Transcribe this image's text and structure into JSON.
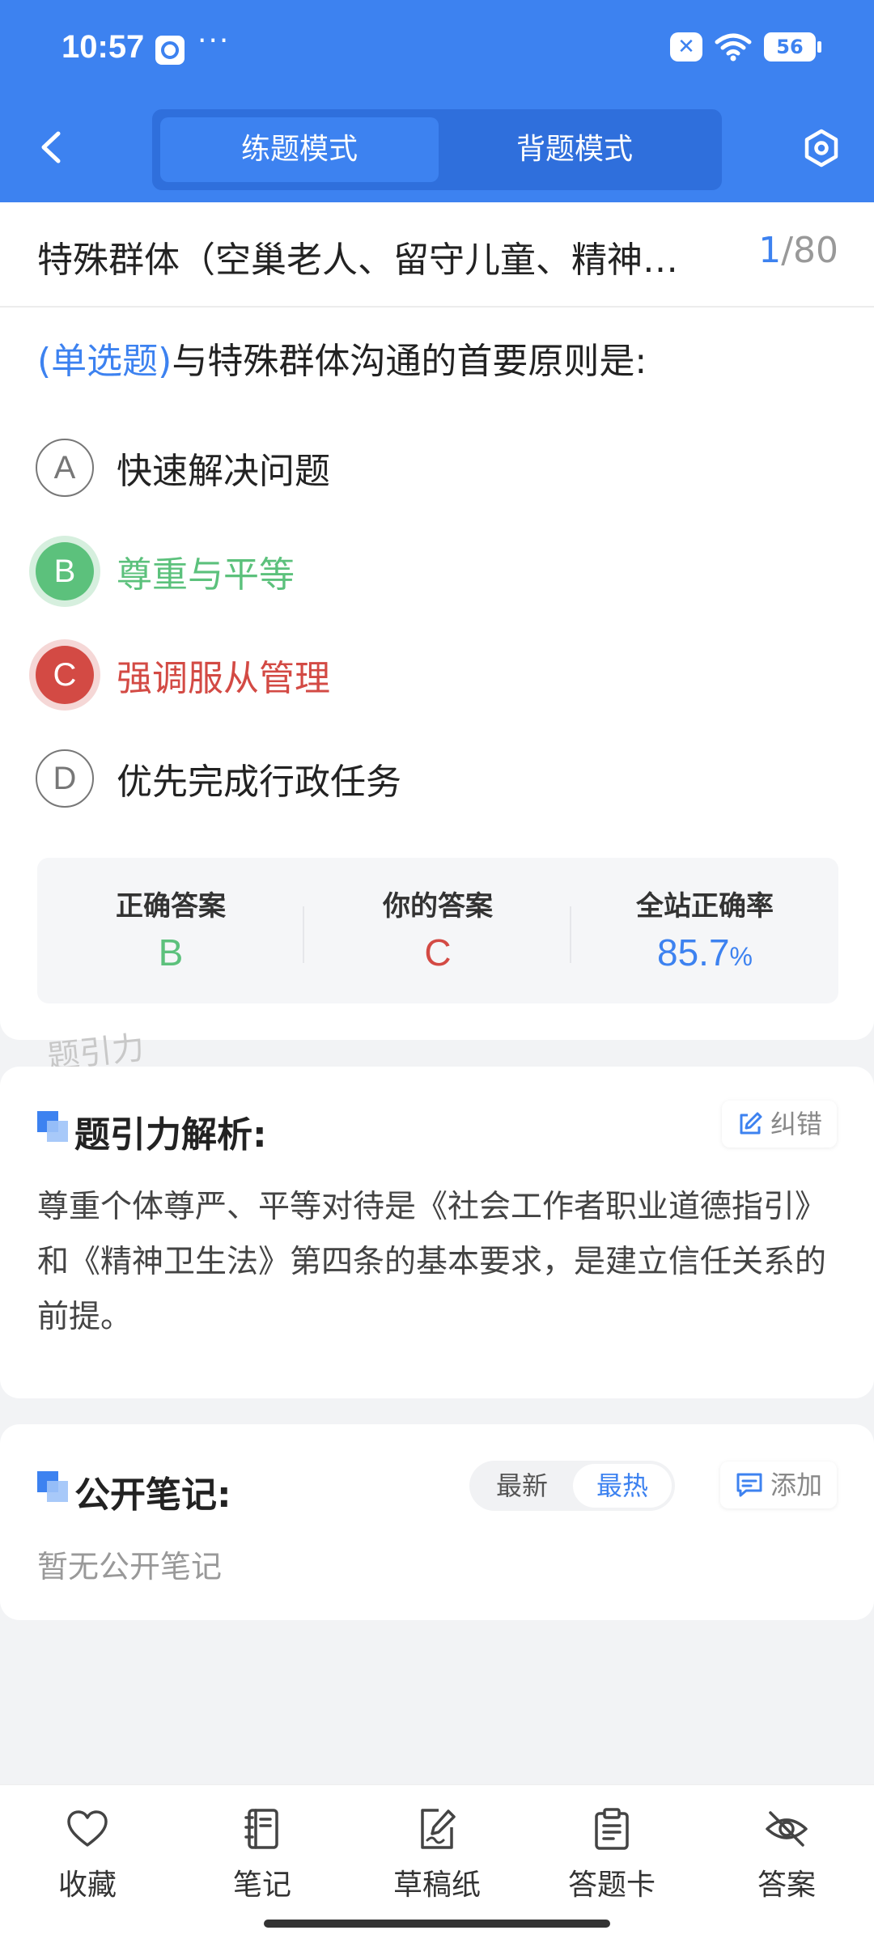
{
  "status_bar": {
    "time": "10:57",
    "dots": "···",
    "battery": "56"
  },
  "header": {
    "tabs": [
      {
        "label": "练题模式",
        "active": true
      },
      {
        "label": "背题模式",
        "active": false
      }
    ]
  },
  "question": {
    "title": "特殊群体（空巢老人、留守儿童、精神…",
    "index_current": "1",
    "index_total": "/80",
    "type_label": "(单选题)",
    "stem": "与特殊群体沟通的首要原则是:",
    "options": [
      {
        "letter": "A",
        "text": "快速解决问题",
        "state": "normal"
      },
      {
        "letter": "B",
        "text": "尊重与平等",
        "state": "correct"
      },
      {
        "letter": "C",
        "text": "强调服从管理",
        "state": "wrong"
      },
      {
        "letter": "D",
        "text": "优先完成行政任务",
        "state": "normal"
      }
    ]
  },
  "answer_summary": {
    "correct_label": "正确答案",
    "correct_value": "B",
    "yours_label": "你的答案",
    "yours_value": "C",
    "rate_label": "全站正确率",
    "rate_value": "85.7",
    "rate_unit": "%"
  },
  "watermark": "题引力",
  "analysis": {
    "title": "题引力解析:",
    "report_button": "纠错",
    "text": "尊重个体尊严、平等对待是《社会工作者职业道德指引》和《精神卫生法》第四条的基本要求，是建立信任关系的前提。"
  },
  "notes": {
    "title": "公开笔记:",
    "sort_latest": "最新",
    "sort_hot": "最热",
    "add_button": "添加",
    "empty_text": "暂无公开笔记"
  },
  "bottom_nav": [
    {
      "label": "收藏",
      "icon": "heart-icon"
    },
    {
      "label": "笔记",
      "icon": "notebook-icon"
    },
    {
      "label": "草稿纸",
      "icon": "draft-pen-icon"
    },
    {
      "label": "答题卡",
      "icon": "clipboard-icon"
    },
    {
      "label": "答案",
      "icon": "eye-off-icon"
    }
  ],
  "colors": {
    "primary": "#3d82f0",
    "correct": "#5cc17c",
    "wrong": "#d34a44"
  }
}
